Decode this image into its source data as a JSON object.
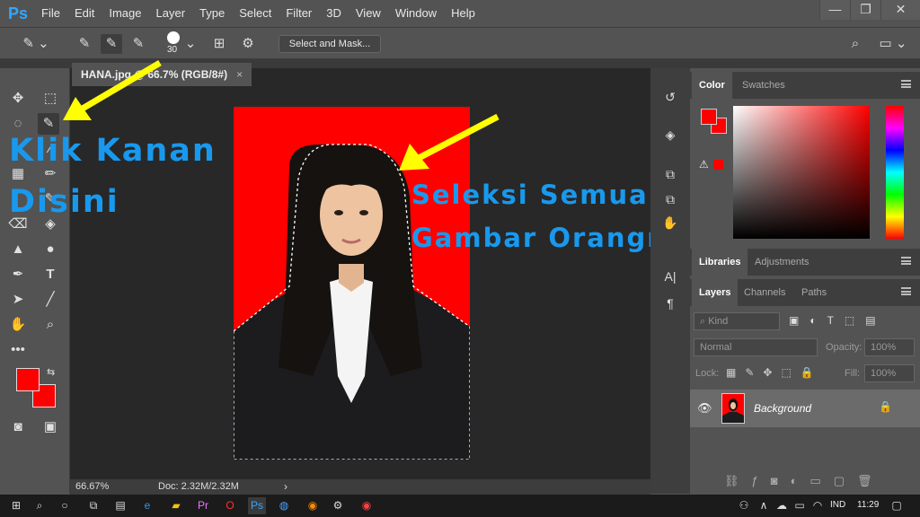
{
  "app": {
    "logo": "Ps"
  },
  "menu": [
    "File",
    "Edit",
    "Image",
    "Layer",
    "Type",
    "Select",
    "Filter",
    "3D",
    "View",
    "Window",
    "Help"
  ],
  "options_bar": {
    "brush_size": "30",
    "select_mask_label": "Select and Mask..."
  },
  "document": {
    "tab_title": "HANA.jpg @ 66.7% (RGB/8#)",
    "close": "×",
    "zoom": "66.67%",
    "doc_info": "Doc: 2.32M/2.32M",
    "expand": "›"
  },
  "annotations": {
    "left_line1": "Klik Kanan",
    "left_line2": "Disini",
    "right_line1": "Seleksi Semua Tepian",
    "right_line2": "Gambar Orangnya"
  },
  "color_panel": {
    "tabs": [
      "Color",
      "Swatches"
    ],
    "foreground": "#ff0000",
    "background": "#ff0000"
  },
  "libraries_panel": {
    "tabs": [
      "Libraries",
      "Adjustments"
    ]
  },
  "layers_panel": {
    "tabs": [
      "Layers",
      "Channels",
      "Paths"
    ],
    "filter_placeholder": "Kind",
    "blend_mode": "Normal",
    "opacity_label": "Opacity:",
    "opacity_value": "100%",
    "lock_label": "Lock:",
    "fill_label": "Fill:",
    "fill_value": "100%",
    "layers": [
      {
        "name": "Background",
        "visible": true,
        "locked": true
      }
    ]
  },
  "taskbar": {
    "language": "IND",
    "time": "11:29"
  },
  "colors": {
    "accent": "#31a8ff",
    "annotation": "#1899ee",
    "arrow": "#ffff00",
    "photo_bg": "#ff0000"
  }
}
